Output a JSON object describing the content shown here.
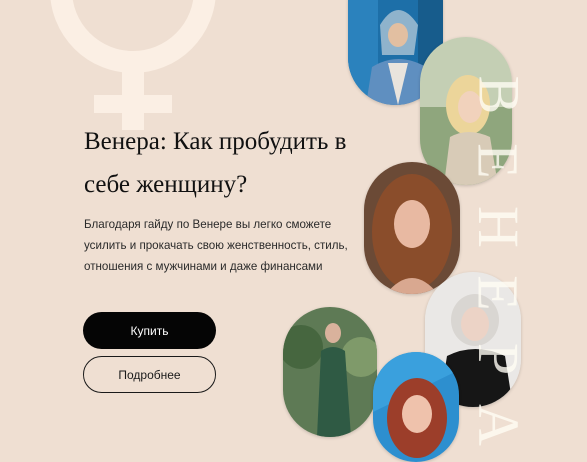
{
  "hero": {
    "title": "Венера: Как пробудить в себе женщину?",
    "description": "Благодаря гайду по Венере вы легко сможете усилить и прокачать свою женственность, стиль, отношения с мужчинами и даже финансами"
  },
  "buttons": {
    "buy_label": "Купить",
    "more_label": "Подробнее"
  },
  "vertical_word": [
    "В",
    "Е",
    "Н",
    "Е",
    "Р",
    "А"
  ],
  "decor": {
    "symbol_icon": "venus-symbol-icon"
  },
  "colors": {
    "background": "#efdfd2",
    "symbol": "#fbefe4",
    "button_dark": "#050505"
  }
}
